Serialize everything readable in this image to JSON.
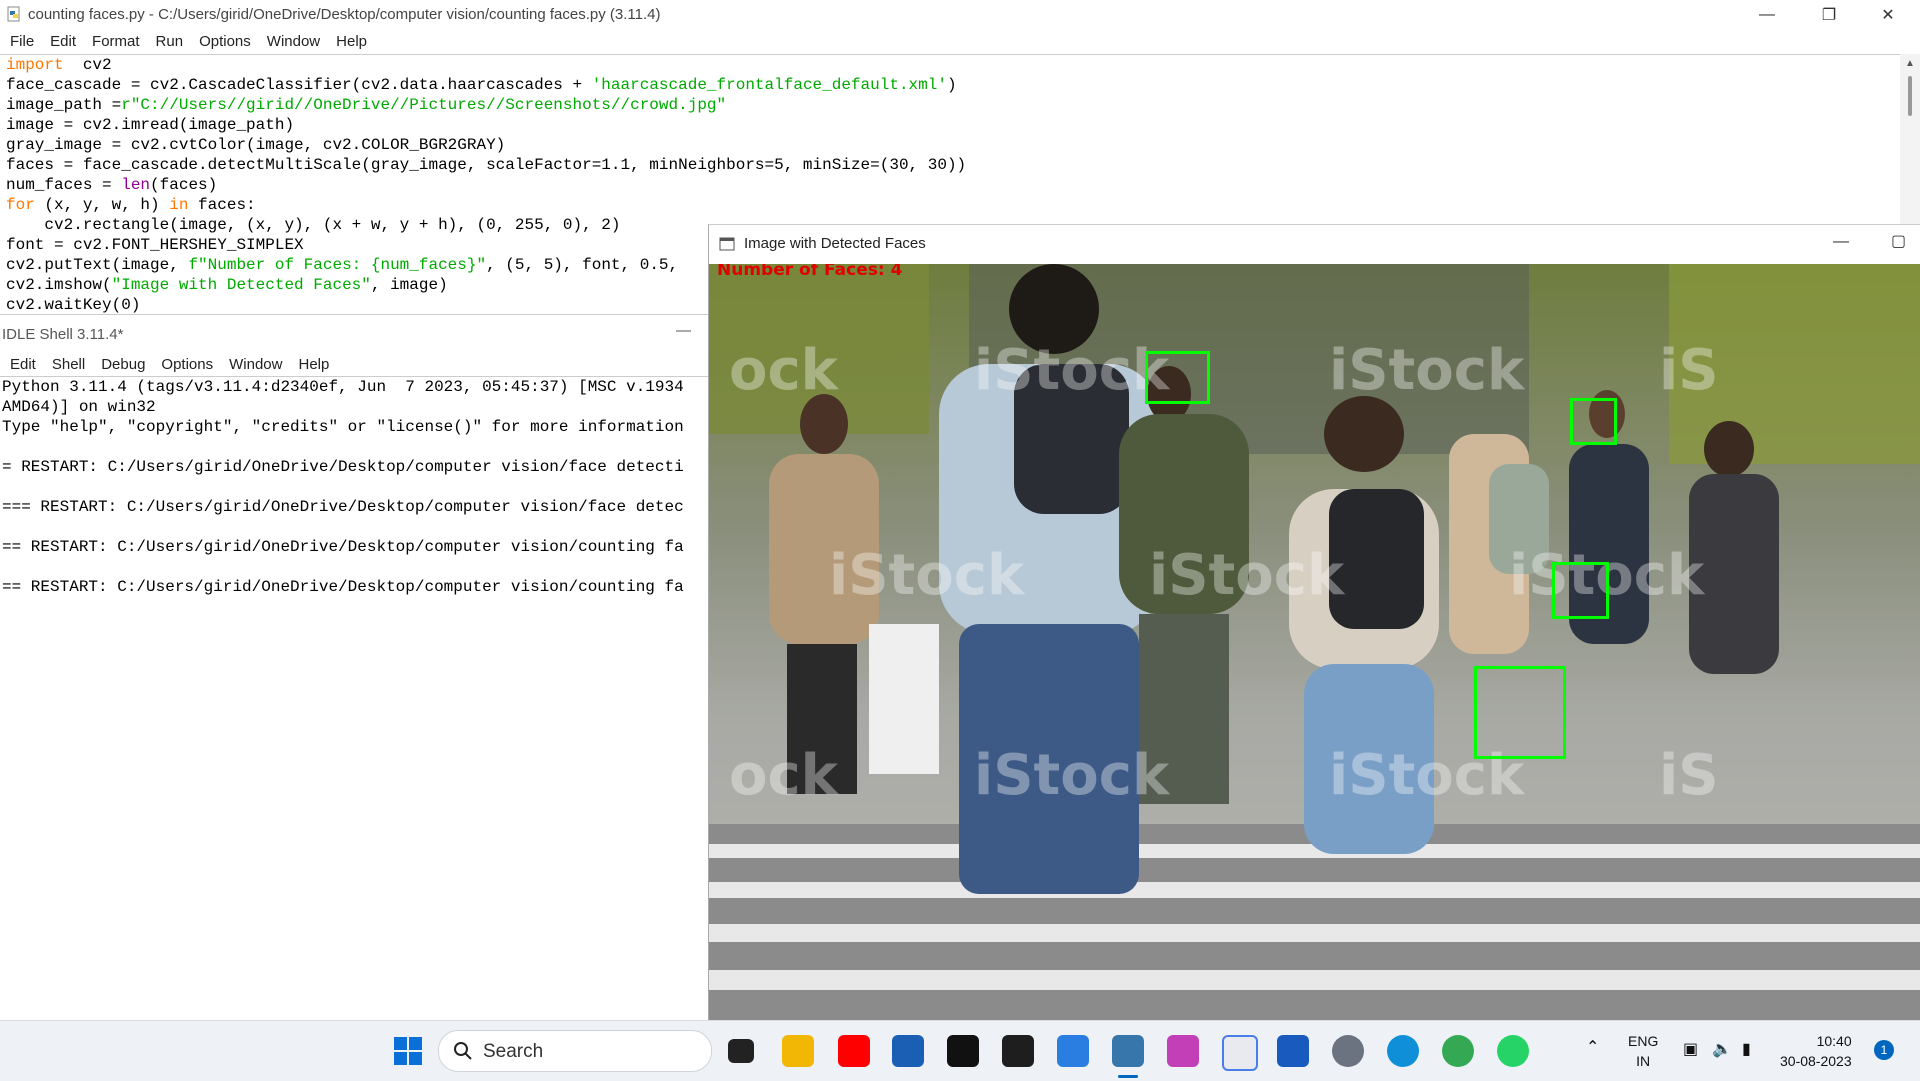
{
  "editor": {
    "title": "counting faces.py - C:/Users/girid/OneDrive/Desktop/computer vision/counting faces.py (3.11.4)",
    "menu": [
      "File",
      "Edit",
      "Format",
      "Run",
      "Options",
      "Window",
      "Help"
    ],
    "code_lines": [
      [
        [
          "kw",
          "import"
        ],
        [
          "",
          "  cv2"
        ]
      ],
      [
        [
          "",
          "face_cascade = cv2.CascadeClassifier(cv2.data.haarcascades + "
        ],
        [
          "str",
          "'haarcascade_frontalface_default.xml'"
        ],
        [
          "",
          ")"
        ]
      ],
      [
        [
          "",
          "image_path ="
        ],
        [
          "str",
          "r\"C://Users//girid//OneDrive//Pictures//Screenshots//crowd.jpg\""
        ]
      ],
      [
        [
          "",
          "image = cv2.imread(image_path)"
        ]
      ],
      [
        [
          "",
          "gray_image = cv2.cvtColor(image, cv2.COLOR_BGR2GRAY)"
        ]
      ],
      [
        [
          "",
          "faces = face_cascade.detectMultiScale(gray_image, scaleFactor=1.1, minNeighbors=5, minSize=(30, 30))"
        ]
      ],
      [
        [
          "",
          "num_faces = "
        ],
        [
          "bi",
          "len"
        ],
        [
          "",
          "(faces)"
        ]
      ],
      [
        [
          "kw",
          "for"
        ],
        [
          "",
          " (x, y, w, h) "
        ],
        [
          "kw",
          "in"
        ],
        [
          "",
          " faces:"
        ]
      ],
      [
        [
          "",
          "    cv2.rectangle(image, (x, y), (x + w, y + h), (0, 255, 0), 2)"
        ]
      ],
      [
        [
          "",
          "font = cv2.FONT_HERSHEY_SIMPLEX"
        ]
      ],
      [
        [
          "",
          "cv2.putText(image, "
        ],
        [
          "str",
          "f\"Number of Faces: {num_faces}\""
        ],
        [
          "",
          ", (5, 5), font, 0.5,"
        ]
      ],
      [
        [
          "",
          "cv2.imshow("
        ],
        [
          "str",
          "\"Image with Detected Faces\""
        ],
        [
          "",
          ", image)"
        ]
      ],
      [
        [
          "",
          "cv2.waitKey(0)"
        ]
      ]
    ]
  },
  "shell": {
    "title": "IDLE Shell 3.11.4*",
    "menu": [
      "Edit",
      "Shell",
      "Debug",
      "Options",
      "Window",
      "Help"
    ],
    "lines": [
      "Python 3.11.4 (tags/v3.11.4:d2340ef, Jun  7 2023, 05:45:37) [MSC v.1934",
      "AMD64)] on win32",
      "Type \"help\", \"copyright\", \"credits\" or \"license()\" for more information",
      "",
      "= RESTART: C:/Users/girid/OneDrive/Desktop/computer vision/face detecti",
      "",
      "=== RESTART: C:/Users/girid/OneDrive/Desktop/computer vision/face detec",
      "",
      "== RESTART: C:/Users/girid/OneDrive/Desktop/computer vision/counting fa",
      "",
      "== RESTART: C:/Users/girid/OneDrive/Desktop/computer vision/counting fa"
    ]
  },
  "cv_window": {
    "title": "Image with Detected Faces",
    "overlay_text": "Number of Faces: 4",
    "watermark": "iStock"
  },
  "taskbar": {
    "search_label": "Search",
    "lang": "ENG",
    "region": "IN",
    "time": "10:40",
    "date": "30-08-2023",
    "notification_count": "1"
  }
}
